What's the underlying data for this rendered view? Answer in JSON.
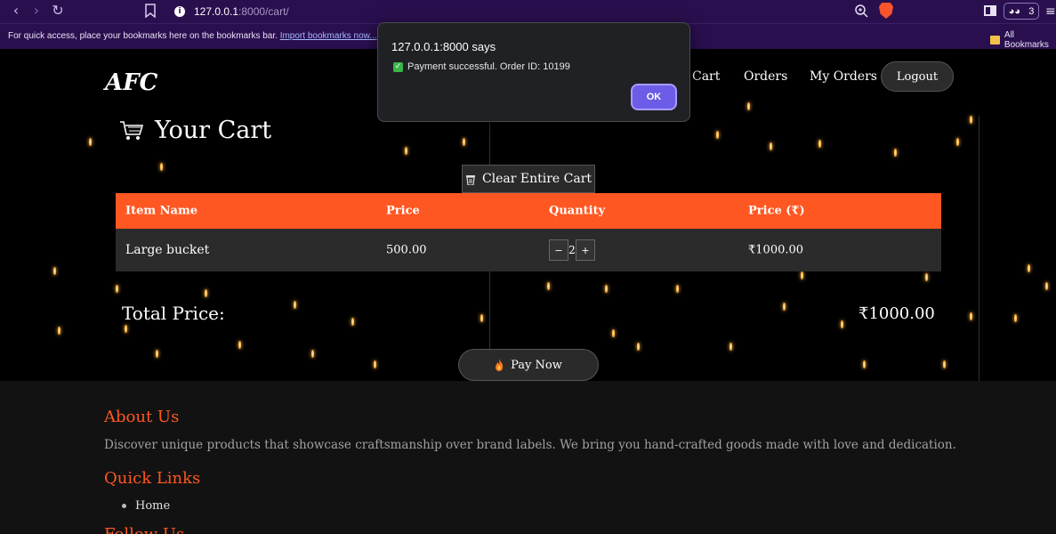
{
  "browser": {
    "url_host": "127.0.0.1",
    "url_path": ":8000/cart/",
    "profile_count": "3",
    "bookmarks_hint": "For quick access, place your bookmarks here on the bookmarks bar.",
    "import_link": "Import bookmarks now...",
    "all_bookmarks": "All Bookmarks"
  },
  "header": {
    "brand": "AFC",
    "nav": [
      "Cart",
      "Orders",
      "My Orders"
    ],
    "logout": "Logout"
  },
  "cart": {
    "title": "Your Cart",
    "clear_label": "Clear Entire Cart",
    "columns": [
      "Item Name",
      "Price",
      "Quantity",
      "Price (₹)"
    ],
    "rows": [
      {
        "name": "Large bucket",
        "price": "500.00",
        "quantity": "2",
        "total": "₹1000.00",
        "minus": "−",
        "plus": "+"
      }
    ],
    "total_label": "Total Price:",
    "total_value": "₹1000.00",
    "pay_label": "Pay Now"
  },
  "footer": {
    "about_title": "About Us",
    "about_text": "Discover unique products that showcase craftsmanship over brand labels. We bring you hand-crafted goods made with love and dedication.",
    "links_title": "Quick Links",
    "links": [
      "Home"
    ],
    "follow_title": "Follow Us"
  },
  "dialog": {
    "title": "127.0.0.1:8000 says",
    "message": "Payment successful. Order ID: 10199",
    "ok": "OK"
  },
  "colors": {
    "accent": "#ff5722",
    "chrome": "#2a0f4f",
    "dialog_button": "#6c5ce7"
  }
}
